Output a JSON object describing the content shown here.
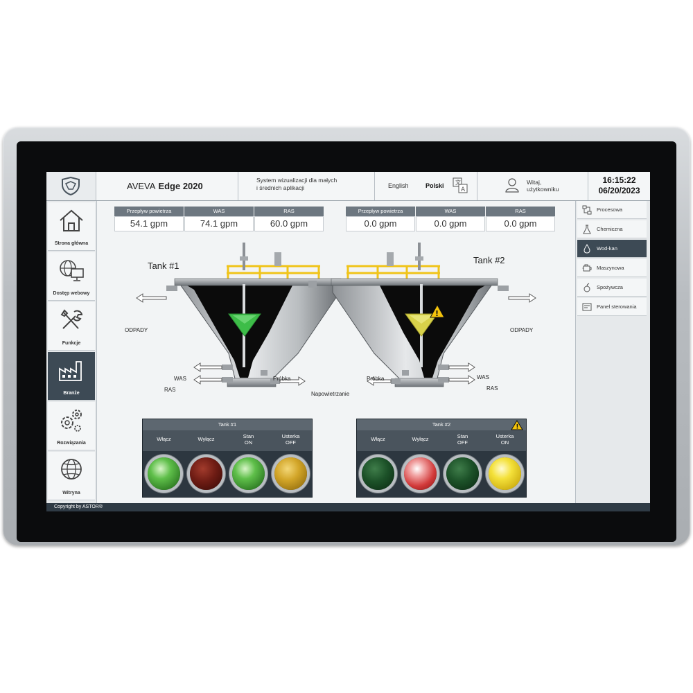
{
  "header": {
    "brand_prefix": "AVEVA",
    "brand_product": "Edge 2020",
    "description_line1": "System wizualizacji dla małych",
    "description_line2": "i średnich aplikacji",
    "lang_english": "English",
    "lang_polish": "Polski",
    "user_line1": "Witaj,",
    "user_line2": "użytkowniku",
    "time": "16:15:22",
    "date": "06/20/2023"
  },
  "left_nav": {
    "items": [
      {
        "label": "Strona główna",
        "icon": "home-icon"
      },
      {
        "label": "Dostęp webowy",
        "icon": "web-icon"
      },
      {
        "label": "Funkcje",
        "icon": "tools-icon"
      },
      {
        "label": "Branże",
        "icon": "factory-icon",
        "active": true
      },
      {
        "label": "Rozwiązania",
        "icon": "gears-icon"
      },
      {
        "label": "Witryna",
        "icon": "globe-icon"
      }
    ]
  },
  "right_nav": {
    "items": [
      {
        "label": "Procesowa",
        "icon": "process-icon"
      },
      {
        "label": "Chemiczna",
        "icon": "flask-icon"
      },
      {
        "label": "Wod-kan",
        "icon": "water-icon",
        "active": true
      },
      {
        "label": "Maszynowa",
        "icon": "engine-icon"
      },
      {
        "label": "Spożywcza",
        "icon": "food-icon"
      },
      {
        "label": "Panel sterowania",
        "icon": "panel-icon"
      }
    ]
  },
  "tank1": {
    "title": "Tank #1",
    "metrics": [
      {
        "label": "Przepływ powietrza",
        "value": "54.1 gpm"
      },
      {
        "label": "WAS",
        "value": "74.1 gpm"
      },
      {
        "label": "RAS",
        "value": "60.0 gpm"
      }
    ],
    "labels": {
      "waste": "ODPADY",
      "was": "WAS",
      "ras": "RAS",
      "sample": "Próbka"
    },
    "funnel_color": "#3dbd48",
    "alarm": false,
    "panel": {
      "title": "Tank #1",
      "columns": [
        {
          "line1": "Włącz",
          "line2": ""
        },
        {
          "line1": "Wyłącz",
          "line2": ""
        },
        {
          "line1": "Stan",
          "line2": "ON"
        },
        {
          "line1": "Usterka",
          "line2": "OFF"
        }
      ],
      "lamps": [
        "bright-green",
        "dark-red",
        "bright-green",
        "dim-yellow"
      ]
    }
  },
  "tank2": {
    "title": "Tank #2",
    "metrics": [
      {
        "label": "Przepływ powietrza",
        "value": "0.0 gpm"
      },
      {
        "label": "WAS",
        "value": "0.0 gpm"
      },
      {
        "label": "RAS",
        "value": "0.0 gpm"
      }
    ],
    "labels": {
      "waste": "ODPADY",
      "was": "WAS",
      "ras": "RAS",
      "sample": "Próbka"
    },
    "funnel_color": "#d8d24a",
    "alarm": true,
    "panel": {
      "title": "Tank #2",
      "columns": [
        {
          "line1": "Włącz",
          "line2": ""
        },
        {
          "line1": "Wyłącz",
          "line2": ""
        },
        {
          "line1": "Stan",
          "line2": "OFF"
        },
        {
          "line1": "Usterka",
          "line2": "ON"
        }
      ],
      "lamps": [
        "dark-green",
        "bright-red",
        "dark-green",
        "bright-yellow"
      ]
    }
  },
  "aeration_label": "Napowietrzanie",
  "footer": "Copyright by ASTOR®"
}
